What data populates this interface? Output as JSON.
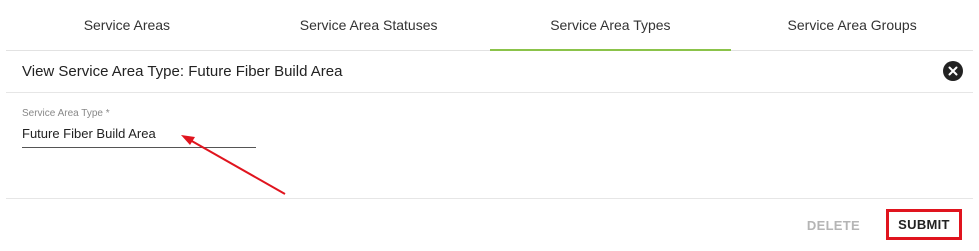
{
  "tabs": [
    {
      "label": "Service Areas",
      "active": false
    },
    {
      "label": "Service Area Statuses",
      "active": false
    },
    {
      "label": "Service Area Types",
      "active": true
    },
    {
      "label": "Service Area Groups",
      "active": false
    }
  ],
  "dialog": {
    "title": "View Service Area Type: Future Fiber Build Area",
    "close_icon": "close-circle-icon"
  },
  "form": {
    "type_label": "Service Area Type *",
    "type_value": "Future Fiber Build Area"
  },
  "actions": {
    "delete_label": "DELETE",
    "submit_label": "SUBMIT"
  },
  "colors": {
    "accent": "#8bc34a",
    "highlight": "#e0141e",
    "disabled_text": "#b5b5b5"
  }
}
